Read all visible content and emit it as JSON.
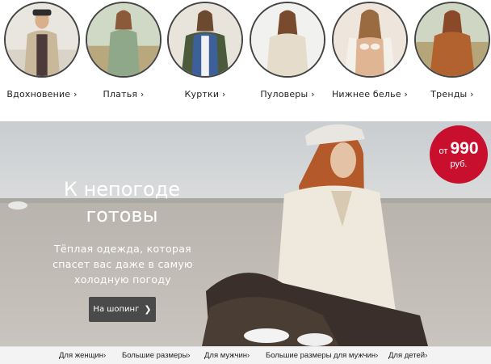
{
  "categories": [
    {
      "label": "Вдохновение ›",
      "icon": "photo-inspiration"
    },
    {
      "label": "Платья ›",
      "icon": "photo-dresses"
    },
    {
      "label": "Куртки ›",
      "icon": "photo-jackets"
    },
    {
      "label": "Пуловеры ›",
      "icon": "photo-pullovers"
    },
    {
      "label": "Нижнее белье ›",
      "icon": "photo-lingerie"
    },
    {
      "label": "Тренды ›",
      "icon": "photo-trends"
    }
  ],
  "hero": {
    "title_line1": "К непогоде",
    "title_line2": "готовы",
    "subtitle_line1": "Тёплая одежда, которая",
    "subtitle_line2": "спасет вас даже в самую",
    "subtitle_line3": "холодную погоду",
    "button_label": "На шопинг",
    "button_icon": "chevron-right-icon"
  },
  "price_badge": {
    "prefix": "от",
    "amount": "990",
    "currency": "руб.",
    "color": "#c8102e"
  },
  "bottom_nav": [
    "Для женщин›",
    "Большие размеры›",
    "Для мужчин›",
    "Большие размеры для мужчин›",
    "Для детей›"
  ]
}
